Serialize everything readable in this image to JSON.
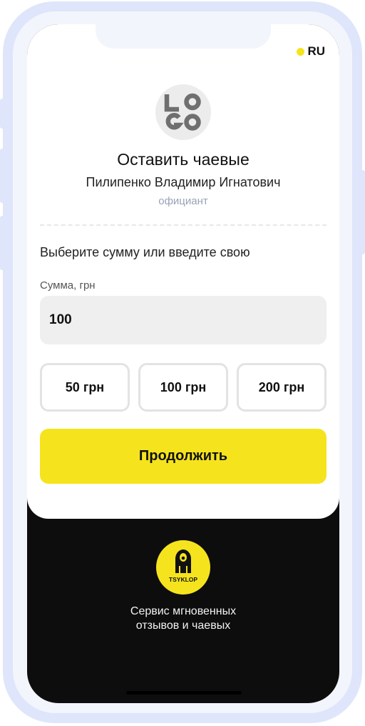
{
  "language": {
    "label": "RU"
  },
  "venue": {
    "logo_text": "LOGO"
  },
  "header": {
    "title": "Оставить чаевые",
    "waiter_name": "Пилипенко Владимир Игнатович",
    "role": "официант"
  },
  "form": {
    "prompt": "Выберите сумму или введите свою",
    "amount_label": "Сумма, грн",
    "amount_value": "100",
    "presets": [
      "50 грн",
      "100 грн",
      "200 грн"
    ],
    "continue_label": "Продолжить"
  },
  "footer": {
    "brand": "TSYKLOP",
    "tagline_line1": "Сервис мгновенных",
    "tagline_line2": "отзывов и чаевых"
  },
  "colors": {
    "accent": "#f5e41d",
    "frame": "#dfe6fb",
    "footer_bg": "#0d0d0d",
    "input_bg": "#efefef"
  }
}
